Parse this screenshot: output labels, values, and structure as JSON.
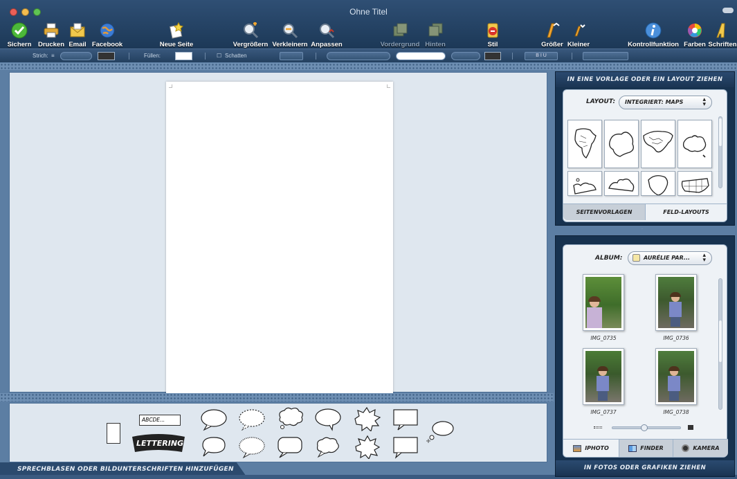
{
  "window": {
    "title": "Ohne Titel",
    "traffic_colors": [
      "#ec5f57",
      "#f4bd4f",
      "#5fc453"
    ]
  },
  "toolbar": {
    "items": [
      {
        "label": "Sichern",
        "icon": "check-circle-icon",
        "enabled": true
      },
      {
        "label": "Drucken",
        "icon": "printer-icon",
        "enabled": true
      },
      {
        "label": "Email",
        "icon": "envelope-icon",
        "enabled": true
      },
      {
        "label": "Facebook",
        "icon": "globe-icon",
        "enabled": true
      },
      {
        "label": "Neue Seite",
        "icon": "new-page-icon",
        "enabled": true
      },
      {
        "label": "Vergrößern",
        "icon": "zoom-in-icon",
        "enabled": true
      },
      {
        "label": "Verkleinern",
        "icon": "zoom-out-icon",
        "enabled": true
      },
      {
        "label": "Anpassen",
        "icon": "zoom-fit-icon",
        "enabled": true
      },
      {
        "label": "Vordergrund",
        "icon": "bring-front-icon",
        "enabled": false
      },
      {
        "label": "Hinten",
        "icon": "send-back-icon",
        "enabled": false
      },
      {
        "label": "Stil",
        "icon": "style-icon",
        "enabled": true
      },
      {
        "label": "Größer",
        "icon": "text-bigger-icon",
        "enabled": true
      },
      {
        "label": "Kleiner",
        "icon": "text-smaller-icon",
        "enabled": true
      },
      {
        "label": "Kontrollfunktion",
        "icon": "info-icon",
        "enabled": true
      },
      {
        "label": "Farben",
        "icon": "color-wheel-icon",
        "enabled": true
      },
      {
        "label": "Schriften",
        "icon": "font-icon",
        "enabled": true
      }
    ]
  },
  "formatbar": {
    "stroke_label": "Strich:",
    "fill_label": "Füllen:",
    "shadow_label": "Schatten",
    "bold": "B",
    "italic": "I",
    "underline": "U"
  },
  "bubbles": {
    "text_sample": "ABCDE...",
    "lettering": "LETTERING",
    "caption": "SPRECHBLASEN ODER BILDUNTERSCHRIFTEN HINZUFÜGEN"
  },
  "layouts_panel": {
    "header": "IN EINE VORLAGE ODER EIN LAYOUT ZIEHEN",
    "layout_label": "LAYOUT:",
    "layout_value": "INTEGRIERT: MAPS",
    "tab_templates": "SEITENVORLAGEN",
    "tab_layouts": "FELD-LAYOUTS"
  },
  "photos_panel": {
    "album_label": "ALBUM:",
    "album_value": "AURÉLIE PAR...",
    "photos": [
      "IMG_0735",
      "IMG_0736",
      "IMG_0737",
      "IMG_0738"
    ],
    "thumb_size": 0.45,
    "tabs": [
      "IPHOTO",
      "FINDER",
      "KAMERA"
    ],
    "footer": "IN FOTOS ODER GRAFIKEN ZIEHEN"
  }
}
